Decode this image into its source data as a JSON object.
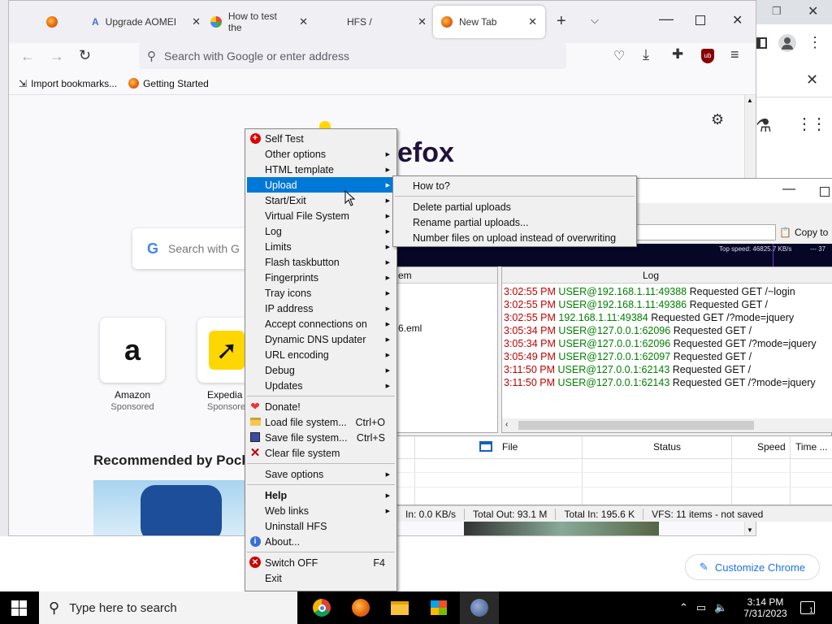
{
  "firefox": {
    "tabs": [
      {
        "label": ""
      },
      {
        "label": "Upgrade AOMEI"
      },
      {
        "label": "How to test the"
      },
      {
        "label": "HFS /"
      },
      {
        "label": "New Tab"
      }
    ],
    "url_placeholder": "Search with Google or enter address",
    "bookmarks": [
      "Import bookmarks...",
      "Getting Started"
    ],
    "page": {
      "brand_text": "efox",
      "search_placeholder": "Search with G",
      "shortcuts": [
        {
          "name": "Amazon",
          "sub": "Sponsored"
        },
        {
          "name": "Expedia",
          "sub": "Sponsore"
        }
      ],
      "recommended": "Recommended by Pocke"
    }
  },
  "chrome": {
    "customize_label": "Customize Chrome"
  },
  "hfs": {
    "copy_label": "Copy to",
    "top_speed": "Top speed: 46825.7 KB/s",
    "graph_right": "--- 37",
    "left_header": "em",
    "left_item": "6.eml",
    "log_header": "Log",
    "log": [
      {
        "time": "3:02:55 PM",
        "addr": "USER@192.168.1.11:49388",
        "msg": "Requested GET /~login"
      },
      {
        "time": "3:02:55 PM",
        "addr": "USER@192.168.1.11:49386",
        "msg": "Requested GET /"
      },
      {
        "time": "3:02:55 PM",
        "addr": "192.168.1.11:49384",
        "msg": "Requested GET /?mode=jquery"
      },
      {
        "time": "3:05:34 PM",
        "addr": "USER@127.0.0.1:62096",
        "msg": "Requested GET /"
      },
      {
        "time": "3:05:34 PM",
        "addr": "USER@127.0.0.1:62096",
        "msg": "Requested GET /?mode=jquery"
      },
      {
        "time": "3:05:49 PM",
        "addr": "USER@127.0.0.1:62097",
        "msg": "Requested GET /"
      },
      {
        "time": "3:11:50 PM",
        "addr": "USER@127.0.0.1:62143",
        "msg": "Requested GET /"
      },
      {
        "time": "3:11:50 PM",
        "addr": "USER@127.0.0.1:62143",
        "msg": "Requested GET /?mode=jquery"
      }
    ],
    "transfer_columns": [
      "File",
      "Status",
      "Speed",
      "Time ..."
    ],
    "status": [
      "In: 0.0 KB/s",
      "Total Out: 93.1 M",
      "Total In: 195.6 K",
      "VFS: 11 items - not saved"
    ]
  },
  "menu": {
    "items": [
      {
        "label": "Self Test",
        "icon": "red-cross-icon"
      },
      {
        "label": "Other options",
        "sub": true
      },
      {
        "label": "HTML template",
        "sub": true
      },
      {
        "label": "Upload",
        "sub": true,
        "highlight": true
      },
      {
        "label": "Start/Exit",
        "sub": true
      },
      {
        "label": "Virtual File System",
        "sub": true
      },
      {
        "label": "Log",
        "sub": true
      },
      {
        "label": "Limits",
        "sub": true
      },
      {
        "label": "Flash taskbutton",
        "sub": true
      },
      {
        "label": "Fingerprints",
        "sub": true
      },
      {
        "label": "Tray icons",
        "sub": true
      },
      {
        "label": "IP address",
        "sub": true
      },
      {
        "label": "Accept connections on",
        "sub": true
      },
      {
        "label": "Dynamic DNS updater",
        "sub": true
      },
      {
        "label": "URL encoding",
        "sub": true
      },
      {
        "label": "Debug",
        "sub": true
      },
      {
        "label": "Updates",
        "sub": true
      },
      {
        "label": "Donate!",
        "icon": "heart-icon"
      },
      {
        "label": "Load file system...",
        "shortcut": "Ctrl+O",
        "icon": "folder-icon"
      },
      {
        "label": "Save file system...",
        "shortcut": "Ctrl+S",
        "icon": "floppy-icon"
      },
      {
        "label": "Clear file system",
        "icon": "x-icon"
      },
      {
        "label": "Save options",
        "sub": true
      },
      {
        "label": "Help",
        "sub": true,
        "bold": true
      },
      {
        "label": "Web links",
        "sub": true
      },
      {
        "label": "Uninstall HFS"
      },
      {
        "label": "About...",
        "icon": "info-icon"
      },
      {
        "label": "Switch OFF",
        "shortcut": "F4",
        "icon": "power-off-icon"
      },
      {
        "label": "Exit"
      }
    ],
    "submenu": [
      "How to?",
      "Delete partial uploads",
      "Rename partial uploads...",
      "Number files on upload instead of overwriting"
    ]
  },
  "taskbar": {
    "search_placeholder": "Type here to search",
    "time": "3:14 PM",
    "date": "7/31/2023",
    "notifications": "1"
  }
}
